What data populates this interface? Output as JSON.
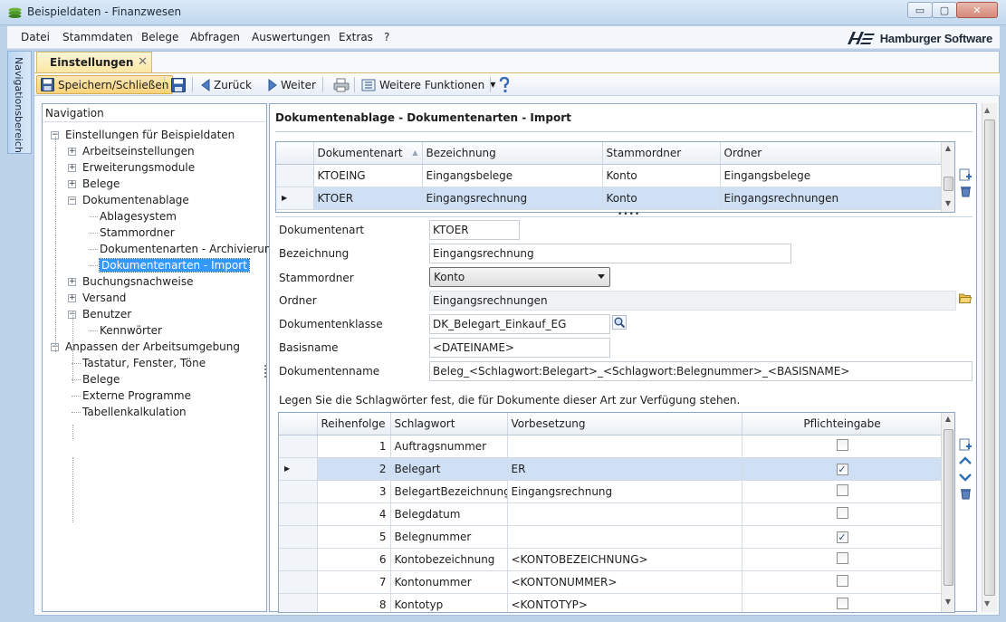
{
  "window": {
    "title": "Beispieldaten - Finanzwesen",
    "controls": {
      "minimize": "▭",
      "maximize": "▢",
      "close": "✕"
    }
  },
  "menu": {
    "items": [
      "Datei",
      "Stammdaten",
      "Belege",
      "Abfragen",
      "Auswertungen",
      "Extras",
      "?"
    ]
  },
  "brand": {
    "logo_text": "Hamburger Software"
  },
  "side_rail": {
    "label": "Navigationsbereich"
  },
  "tab": {
    "label": "Einstellungen",
    "close_glyph": "✕"
  },
  "toolbar": {
    "save_close": "Speichern/Schließen",
    "back": "Zurück",
    "forward": "Weiter",
    "more_functions": "Weitere Funktionen"
  },
  "navigation": {
    "header": "Navigation",
    "tree": [
      {
        "label": "Einstellungen für Beispieldaten",
        "expander": "−"
      },
      {
        "label": "Arbeitseinstellungen",
        "expander": "+"
      },
      {
        "label": "Erweiterungsmodule",
        "expander": "+"
      },
      {
        "label": "Belege",
        "expander": "+"
      },
      {
        "label": "Dokumentenablage",
        "expander": "−"
      },
      {
        "label": "Ablagesystem"
      },
      {
        "label": "Stammordner"
      },
      {
        "label": "Dokumentenarten - Archivierung"
      },
      {
        "label": "Dokumentenarten - Import",
        "selected": true
      },
      {
        "label": "Buchungsnachweise",
        "expander": "+"
      },
      {
        "label": "Versand",
        "expander": "+"
      },
      {
        "label": "Benutzer",
        "expander": "−"
      },
      {
        "label": "Kennwörter"
      },
      {
        "label": "Anpassen der Arbeitsumgebung",
        "expander": "−"
      },
      {
        "label": "Tastatur, Fenster, Töne"
      },
      {
        "label": "Belege"
      },
      {
        "label": "Externe Programme"
      },
      {
        "label": "Tabellenkalkulation"
      }
    ]
  },
  "detail": {
    "title": "Dokumentenablage - Dokumentenarten - Import",
    "doc_types_grid": {
      "columns": [
        "Dokumentenart",
        "Bezeichnung",
        "Stammordner",
        "Ordner"
      ],
      "rows": [
        {
          "art": "KTOEING",
          "bezeichnung": "Eingangsbelege",
          "stammordner": "Konto",
          "ordner": "Eingangsbelege"
        },
        {
          "art": "KTOER",
          "bezeichnung": "Eingangsrechnung",
          "stammordner": "Konto",
          "ordner": "Eingangsrechnungen",
          "selected": true
        }
      ],
      "row_marker": "▶"
    },
    "form": {
      "dokumentenart": {
        "label": "Dokumentenart",
        "value": "KTOER"
      },
      "bezeichnung": {
        "label": "Bezeichnung",
        "value": "Eingangsrechnung"
      },
      "stammordner": {
        "label": "Stammordner",
        "value": "Konto"
      },
      "ordner": {
        "label": "Ordner",
        "value": "Eingangsrechnungen"
      },
      "dokumentenklasse": {
        "label": "Dokumentenklasse",
        "value": "DK_Belegart_Einkauf_EG"
      },
      "basisname": {
        "label": "Basisname",
        "value": "<DATEINAME>"
      },
      "dokumentenname": {
        "label": "Dokumentenname",
        "value": "Beleg_<Schlagwort:Belegart>_<Schlagwort:Belegnummer>_<BASISNAME>"
      }
    },
    "hint": "Legen Sie die Schlagwörter fest, die für Dokumente dieser Art zur Verfügung stehen.",
    "keywords_grid": {
      "columns": [
        "Reihenfolge",
        "Schlagwort",
        "Vorbesetzung",
        "Pflichteingabe"
      ],
      "rows": [
        {
          "order": "1",
          "keyword": "Auftragsnummer",
          "default": "",
          "required": false
        },
        {
          "order": "2",
          "keyword": "Belegart",
          "default": "ER",
          "required": true,
          "selected": true
        },
        {
          "order": "3",
          "keyword": "BelegartBezeichnung",
          "default": "Eingangsrechnung",
          "required": false
        },
        {
          "order": "4",
          "keyword": "Belegdatum",
          "default": "",
          "required": false
        },
        {
          "order": "5",
          "keyword": "Belegnummer",
          "default": "",
          "required": true
        },
        {
          "order": "6",
          "keyword": "Kontobezeichnung",
          "default": "<KONTOBEZEICHNUNG>",
          "required": false
        },
        {
          "order": "7",
          "keyword": "Kontonummer",
          "default": "<KONTONUMMER>",
          "required": false
        },
        {
          "order": "8",
          "keyword": "Kontotyp",
          "default": "<KONTOTYP>",
          "required": false
        }
      ],
      "check_glyph": "✓"
    }
  }
}
